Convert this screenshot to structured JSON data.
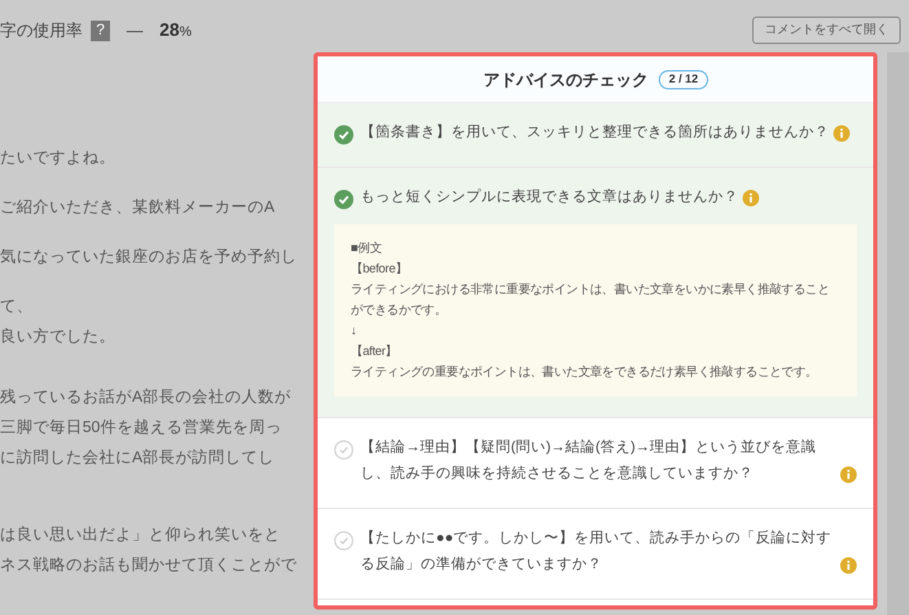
{
  "usage": {
    "label": "字の使用率",
    "help": "?",
    "dash": "—",
    "value": "28",
    "unit": "%"
  },
  "open_all_button": "コメントをすべて開く",
  "article": {
    "paragraphs": [
      [
        "たいですよね。"
      ],
      [
        "ご紹介いただき、某飲料メーカーのA"
      ],
      [
        "気になっていた銀座のお店を予め予約し"
      ],
      [
        "て、",
        "良い方でした。"
      ],
      [
        "残っているお話がA部長の会社の人数が",
        "三脚で毎日50件を越える営業先を周っ",
        "に訪問した会社にA部長が訪問してし"
      ],
      [
        "は良い思い出だよ」と仰られ笑いをと",
        "ネス戦略のお話も聞かせて頂くことがで"
      ]
    ]
  },
  "advice_panel": {
    "title": "アドバイスのチェック",
    "count": "2 / 12",
    "items": [
      {
        "text": "【箇条書き】を用いて、スッキリと整理できる箇所はありませんか？",
        "checked": true
      },
      {
        "text": "もっと短くシンプルに表現できる文章はありませんか？",
        "checked": true,
        "example": [
          "■例文",
          "【before】",
          "ライティングにおける非常に重要なポイントは、書いた文章をいかに素早く推敲することができるかです。",
          "↓",
          "【after】",
          "ライティングの重要なポイントは、書いた文章をできるだけ素早く推敲することです。"
        ]
      },
      {
        "text": "【結論→理由】【疑問(問い)→結論(答え)→理由】という並びを意識し、読み手の興味を持続させることを意識していますか？",
        "checked": false
      },
      {
        "text": "【たしかに●●です。しかし〜】を用いて、読み手からの「反論に対する反論」の準備ができていますか？",
        "checked": false
      }
    ]
  }
}
